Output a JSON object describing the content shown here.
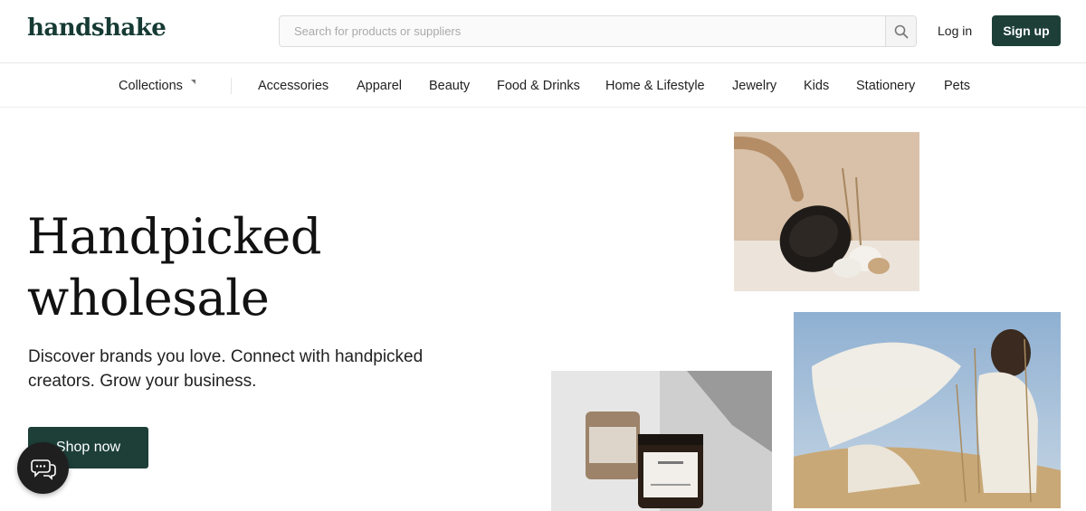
{
  "header": {
    "logo": "handshake",
    "search_placeholder": "Search for products or suppliers",
    "search_icon": "search-icon",
    "login_label": "Log in",
    "signup_label": "Sign up"
  },
  "nav": {
    "collections_label": "Collections",
    "items": [
      "Accessories",
      "Apparel",
      "Beauty",
      "Food & Drinks",
      "Home & Lifestyle",
      "Jewelry",
      "Kids",
      "Stationery",
      "Pets"
    ]
  },
  "hero": {
    "title_line1": "Handpicked",
    "title_line2": "wholesale",
    "subtitle_line1": "Discover brands you love. Connect with handpicked",
    "subtitle_line2": "creators. Grow your business.",
    "cta_label": "Shop now"
  },
  "chat": {
    "icon": "chat-icon"
  },
  "colors": {
    "brand_dark_green": "#1d3f38",
    "logo_green": "#163a34",
    "chat_bg": "#1f1f1f"
  }
}
